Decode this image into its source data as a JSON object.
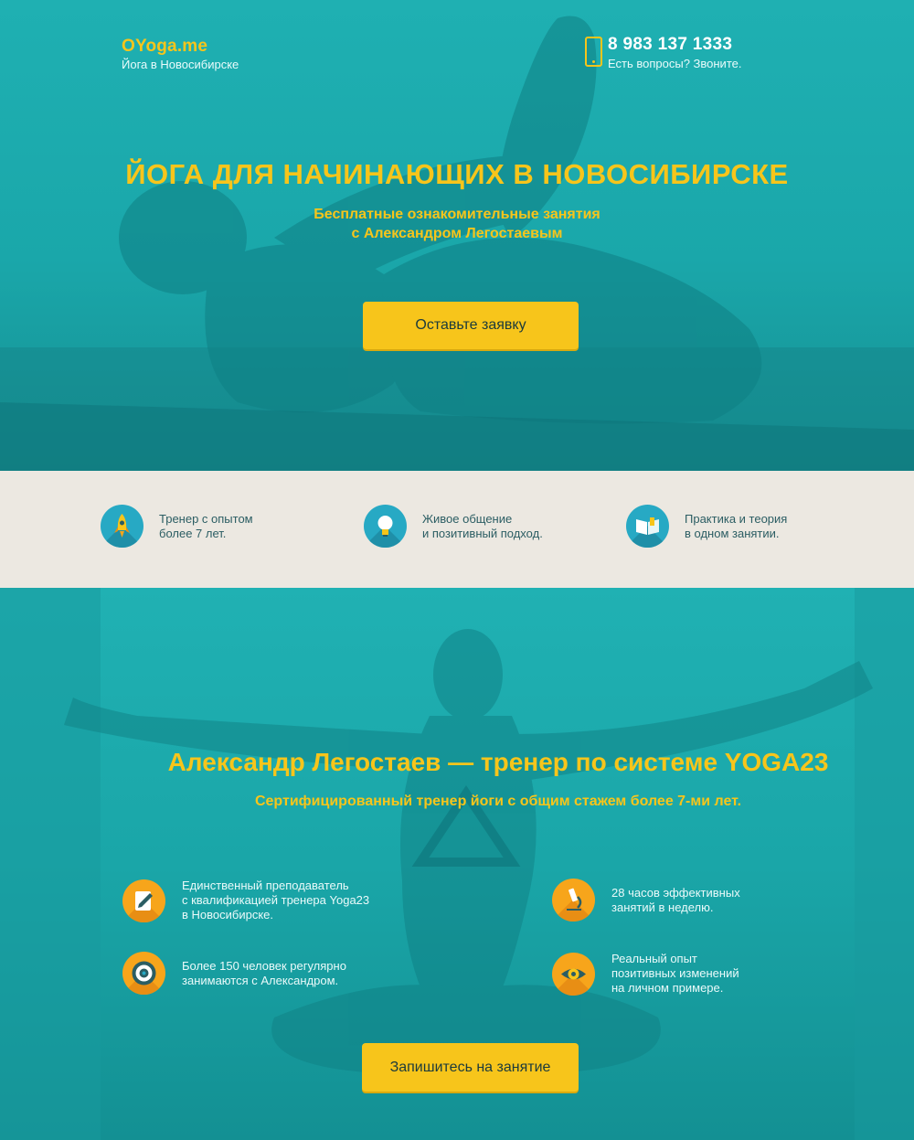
{
  "header": {
    "logo_name": "OYoga.me",
    "logo_sub": "Йога в Новосибирске",
    "phone": "8 983 137 1333",
    "phone_sub": "Есть вопросы? Звоните.",
    "phone_icon": "smartphone-icon"
  },
  "hero": {
    "title": "ЙОГА ДЛЯ НАЧИНАЮЩИХ В НОВОСИБИРСКЕ",
    "subtitle_line1": "Бесплатные ознакомительные занятия",
    "subtitle_line2": "с Александром Легостаевым",
    "cta": "Оставьте заявку"
  },
  "features": [
    {
      "icon": "rocket-icon",
      "line1": "Тренер с опытом",
      "line2": "более 7 лет."
    },
    {
      "icon": "lightbulb-icon",
      "line1": "Живое общение",
      "line2": "и позитивный подход."
    },
    {
      "icon": "book-icon",
      "line1": "Практика и теория",
      "line2": "в одном занятии."
    }
  ],
  "trainer": {
    "title": "Александр Легостаев — тренер по системе YOGA23",
    "subtitle": "Сертифицированный тренер йоги с общим стажем более 7-ми лет.",
    "benefits": [
      {
        "icon": "certificate-icon",
        "lines": [
          "Единственный преподаватель",
          "с квалификацией тренера Yoga23",
          "в Новосибирске."
        ]
      },
      {
        "icon": "microscope-icon",
        "lines": [
          "28 часов эффективных",
          "занятий в неделю."
        ]
      },
      {
        "icon": "target-icon",
        "lines": [
          "Более 150 человек регулярно",
          "занимаются с Александром."
        ]
      },
      {
        "icon": "eye-icon",
        "lines": [
          "Реальный опыт",
          "позитивных изменений",
          "на личном примере."
        ]
      }
    ],
    "cta": "Запишитесь на занятие"
  },
  "colors": {
    "accent_yellow": "#f7c51b",
    "teal": "#1aa7aa",
    "feature_band": "#ece8e1",
    "feature_icon_blue": "#27a9c4",
    "benefit_icon_orange": "#f7a51b"
  }
}
